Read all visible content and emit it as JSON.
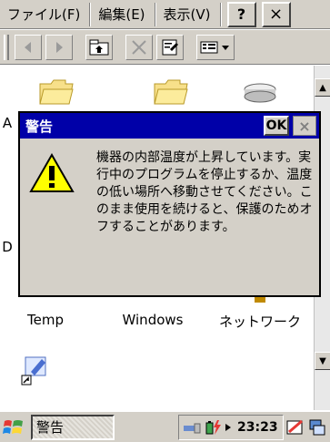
{
  "menubar": {
    "items": [
      "ファイル(F)",
      "編集(E)",
      "表示(V)"
    ],
    "help_label": "?",
    "close_label": "×"
  },
  "toolbar": {
    "icons": [
      "back-arrow-icon",
      "forward-arrow-icon",
      "up-folder-icon",
      "delete-icon",
      "properties-icon",
      "view-menu-icon"
    ]
  },
  "explorer": {
    "items": [
      {
        "label": "A",
        "icon": "folder-icon"
      },
      {
        "label": "",
        "icon": "folder-icon"
      },
      {
        "label": "",
        "icon": "drive-icon"
      },
      {
        "label": "D",
        "icon": ""
      },
      {
        "label": "Temp",
        "icon": "folder-icon"
      },
      {
        "label": "Windows",
        "icon": "folder-icon"
      },
      {
        "label": "ネットワーク",
        "icon": "network-icon"
      },
      {
        "label": "",
        "icon": "shortcut-icon"
      }
    ]
  },
  "dialog": {
    "title": "警告",
    "ok_label": "OK",
    "close_label": "×",
    "message": "機器の内部温度が上昇しています。実行中のプログラムを停止するか、温度の低い場所へ移動させてください。このまま使用を続けると、保護のためオフすることがあります。"
  },
  "taskbar": {
    "task_label": "警告",
    "clock": "23:23"
  },
  "colors": {
    "title_bar": "#0000a8",
    "face": "#d4d0c8",
    "warning_yellow": "#ffff00"
  }
}
